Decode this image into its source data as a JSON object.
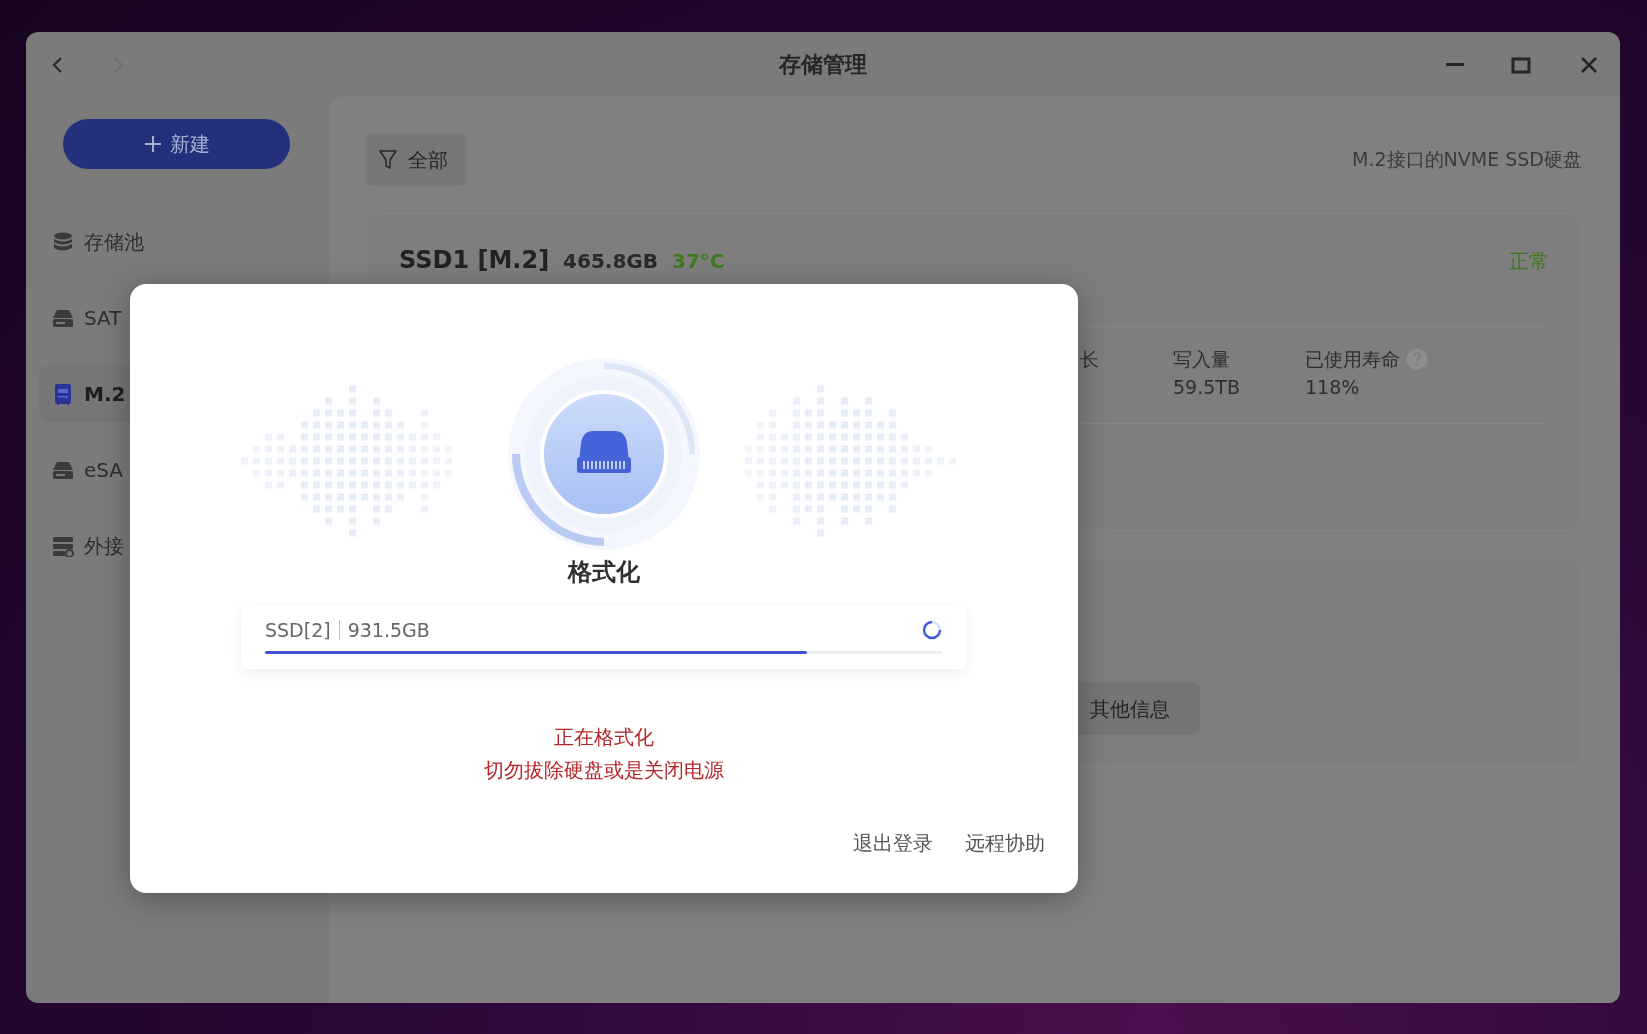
{
  "window": {
    "title": "存储管理",
    "back_enabled": true,
    "forward_enabled": false
  },
  "sidebar": {
    "new_button": "新建",
    "items": [
      {
        "kind": "pool",
        "label": "存储池",
        "selected": false
      },
      {
        "kind": "drive",
        "label": "SAT",
        "selected": false
      },
      {
        "kind": "m2",
        "label": "M.2",
        "selected": true
      },
      {
        "kind": "drive",
        "label": "eSA",
        "selected": false
      },
      {
        "kind": "external",
        "label": "外接",
        "selected": false
      }
    ]
  },
  "toolbar": {
    "filter": "全部",
    "description": "M.2接口的NVME SSD硬盘"
  },
  "disk_card": {
    "name": "SSD1 [M.2]",
    "capacity": "465.8GB",
    "temperature": "37°C",
    "status": "正常",
    "stats": [
      {
        "label": "长",
        "help": false
      },
      {
        "label": "写入量",
        "value": "59.5TB",
        "help": false
      },
      {
        "label": "已使用寿命",
        "value": "118%",
        "help": true
      }
    ]
  },
  "info_card": {
    "button": "其他信息"
  },
  "dialog": {
    "title": "格式化",
    "disk": {
      "name": "SSD[2]",
      "size": "931.5GB",
      "level": 0.8,
      "busy": true
    },
    "warning": [
      "正在格式化",
      "切勿拔除硬盘或是关闭电源"
    ],
    "links": [
      "退出登录",
      "远程协助"
    ]
  }
}
